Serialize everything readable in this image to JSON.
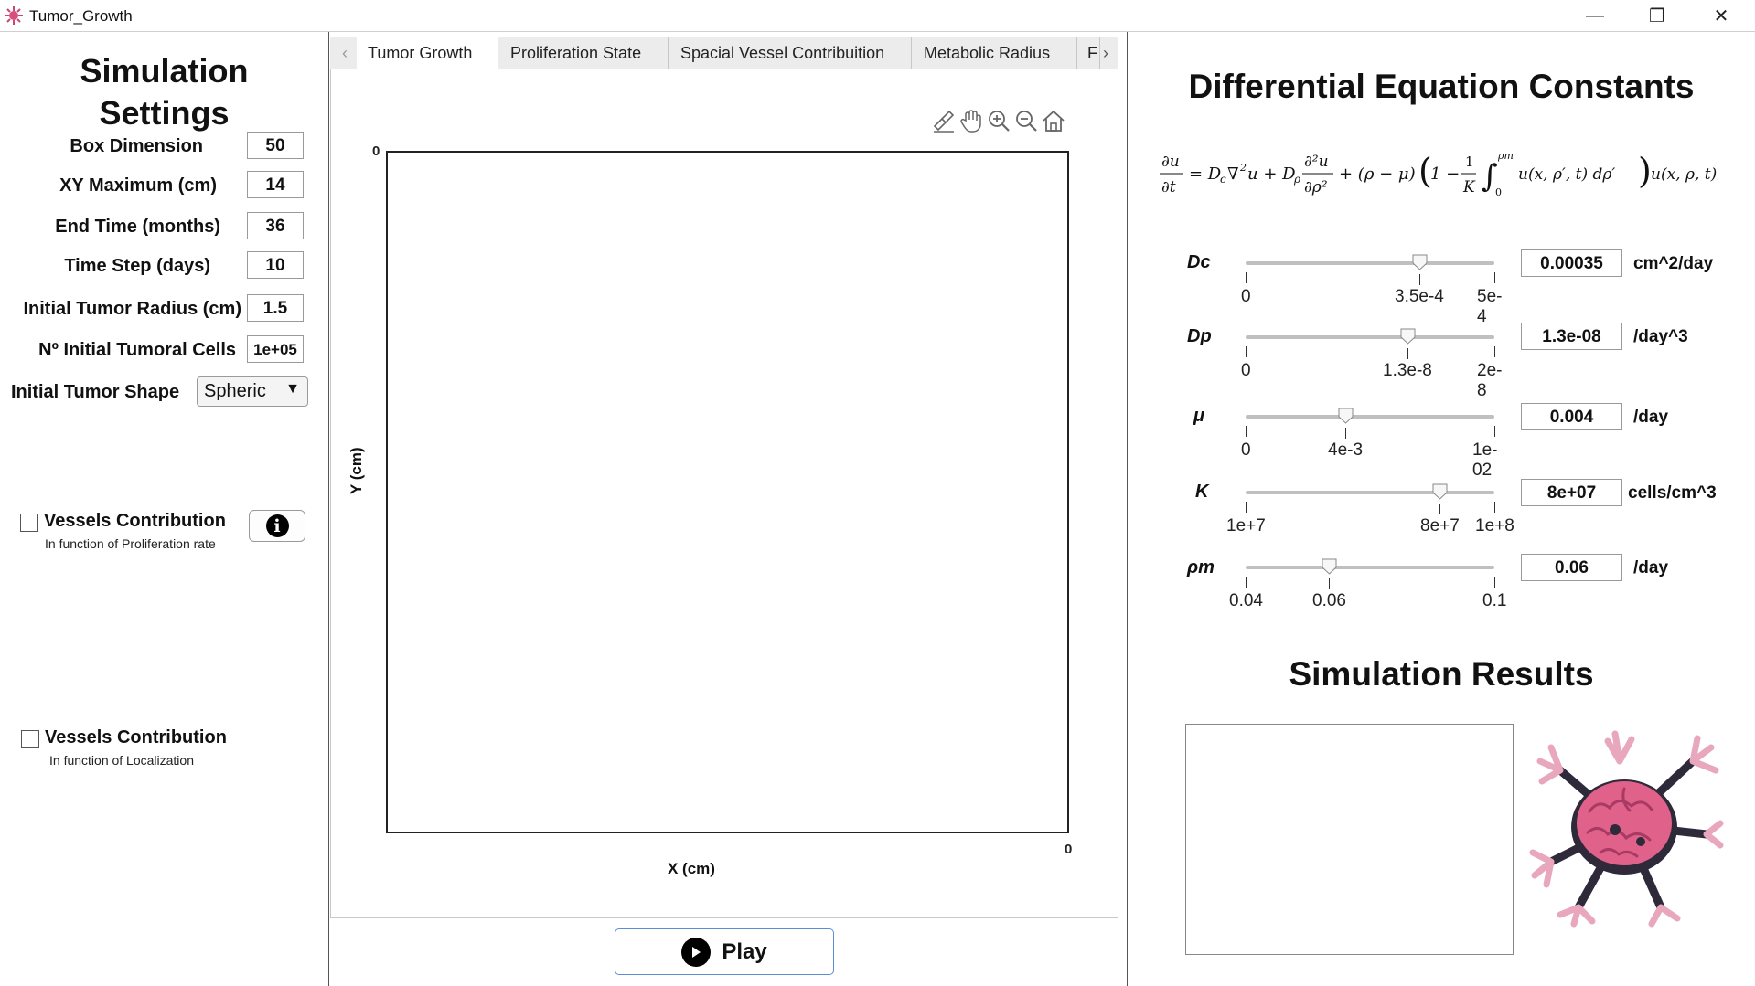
{
  "window": {
    "title": "Tumor_Growth",
    "minimize_glyph": "—",
    "restore_glyph": "❐",
    "close_glyph": "✕"
  },
  "settings": {
    "title_line1": "Simulation",
    "title_line2": "Settings",
    "fields": [
      {
        "label": "Box Dimension",
        "value": "50"
      },
      {
        "label": "XY Maximum (cm)",
        "value": "14"
      },
      {
        "label": "End Time (months)",
        "value": "36"
      },
      {
        "label": "Time Step (days)",
        "value": "10"
      },
      {
        "label": "Initial Tumor Radius (cm)",
        "value": "1.5"
      },
      {
        "label": "Nº Initial Tumoral Cells",
        "value": "1e+05"
      }
    ],
    "shape_label": "Initial Tumor Shape",
    "shape_value": "Spheric",
    "vessels_prolif": {
      "label": "Vessels Contribution",
      "sub": "In function of Proliferation rate",
      "checked": false
    },
    "vessels_local": {
      "label": "Vessels Contribution",
      "sub": "In function of Localization",
      "checked": false
    },
    "info_icon": "info-icon"
  },
  "tabs": {
    "items": [
      {
        "label": "Tumor Growth",
        "active": true
      },
      {
        "label": "Proliferation State",
        "active": false
      },
      {
        "label": "Spacial Vessel Contribuition",
        "active": false
      },
      {
        "label": "Metabolic Radius",
        "active": false
      },
      {
        "label": "F",
        "active": false
      }
    ]
  },
  "plot": {
    "xlabel": "X (cm)",
    "ylabel": "Y (cm)",
    "x_tick": "0",
    "y_tick": "0",
    "toolbar": [
      "brush-icon",
      "pan-icon",
      "zoom-in-icon",
      "zoom-out-icon",
      "home-icon"
    ]
  },
  "play_button": {
    "label": "Play"
  },
  "constants": {
    "title": "Differential Equation Constants",
    "params": [
      {
        "name": "Dc",
        "value": "0.00035",
        "unit": "cm^2/day",
        "ticks": [
          "0",
          "3.5e-4",
          "5e-4"
        ],
        "slider_fraction": 0.7
      },
      {
        "name": "Dp",
        "value": "1.3e-08",
        "unit": "/day^3",
        "ticks": [
          "0",
          "1.3e-8",
          "2e-8"
        ],
        "slider_fraction": 0.65
      },
      {
        "name": "μ",
        "value": "0.004",
        "unit": "/day",
        "ticks": [
          "0",
          "4e-3",
          "1e-02"
        ],
        "slider_fraction": 0.4
      },
      {
        "name": "K",
        "value": "8e+07",
        "unit": "cells/cm^3",
        "ticks": [
          "1e+7",
          "8e+7",
          "1e+8"
        ],
        "slider_fraction": 0.78
      },
      {
        "name": "ρm",
        "value": "0.06",
        "unit": "/day",
        "ticks": [
          "0.04",
          "0.06",
          "0.1"
        ],
        "slider_fraction": 0.333
      }
    ]
  },
  "results": {
    "title": "Simulation Results"
  },
  "colors": {
    "accent": "#5a8fd6",
    "tumor_pink": "#e0628a",
    "tumor_dark": "#2e2a3a",
    "vessel_pink": "#e8a7bd"
  }
}
